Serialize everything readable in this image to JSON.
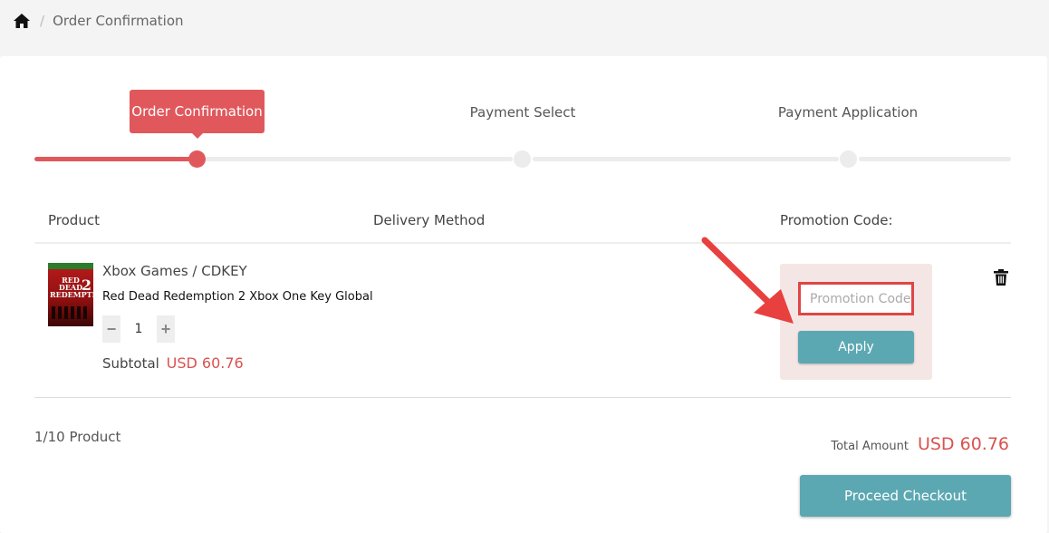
{
  "breadcrumb": {
    "home_icon": "home-icon",
    "separator": "/",
    "current": "Order Confirmation"
  },
  "steps": [
    {
      "label": "Order Confirmation",
      "state": "active"
    },
    {
      "label": "Payment Select",
      "state": "pending"
    },
    {
      "label": "Payment Application",
      "state": "pending"
    }
  ],
  "table": {
    "headers": {
      "product": "Product",
      "delivery": "Delivery Method",
      "promotion": "Promotion Code:"
    }
  },
  "item": {
    "category": "Xbox Games / CDKEY",
    "name": "Red Dead Redemption 2 Xbox One Key Global",
    "quantity": "1",
    "minus": "−",
    "plus": "+",
    "subtotal_label": "Subtotal",
    "subtotal_value": "USD 60.76",
    "cover_title": "RED DEAD REDEMPTION",
    "cover_number": "2"
  },
  "promo": {
    "placeholder": "Promotion Code",
    "value": "",
    "apply_label": "Apply"
  },
  "footer": {
    "count": "1/10 Product",
    "total_label": "Total Amount",
    "total_value": "USD 60.76",
    "checkout_label": "Proceed Checkout"
  },
  "colors": {
    "accent_red": "#e0585c",
    "price_red": "#d9534f",
    "teal_button": "#5ca8b2",
    "annotation_red": "#e8403f"
  },
  "icons": {
    "home": "home-icon",
    "trash": "trash-icon",
    "annotation": "annotation-arrow-icon"
  }
}
